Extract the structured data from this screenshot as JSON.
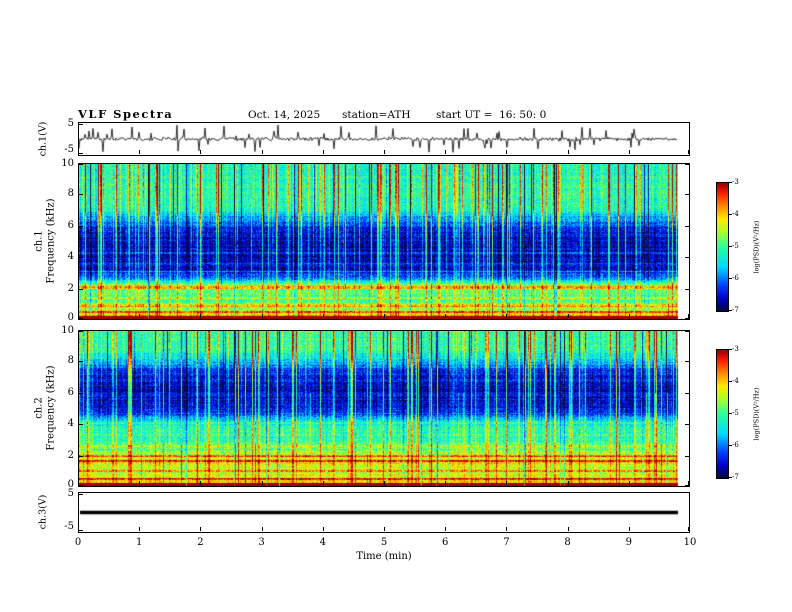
{
  "header": {
    "title": "VLF Spectra",
    "date": "Oct. 14, 2025",
    "station": "station=ATH",
    "start_ut": "start UT =  16: 50: 0"
  },
  "xaxis": {
    "label": "Time (min)",
    "min": 0,
    "max": 10,
    "ticks": [
      0,
      1,
      2,
      3,
      4,
      5,
      6,
      7,
      8,
      9,
      10
    ],
    "data_end_min": 9.8
  },
  "panels": {
    "ch1_wave": {
      "ylabel": "ch.1(V)",
      "ymax_label": "5",
      "ymin_label": "-5",
      "ylim": [
        -5,
        5
      ]
    },
    "ch1_spec": {
      "ylabel_line1": "ch.1",
      "ylabel_line2": "Frequency (kHz)",
      "yticks": [
        0,
        2,
        4,
        6,
        8,
        10
      ],
      "ylim": [
        0,
        10
      ]
    },
    "ch2_spec": {
      "ylabel_line1": "ch.2",
      "ylabel_line2": "Frequency (kHz)",
      "yticks": [
        0,
        2,
        4,
        6,
        8,
        10
      ],
      "ylim": [
        0,
        10
      ]
    },
    "ch3_wave": {
      "ylabel": "ch.3(V)",
      "ymax_label": "5",
      "ymin_label": "-5",
      "ylim": [
        -5,
        5
      ]
    }
  },
  "colorbar": {
    "label": "log(PSD)(V²/Hz)",
    "ticks": [
      -3,
      -4,
      -5,
      -6,
      -7
    ],
    "min": -7,
    "max": -3
  },
  "chart_data": [
    {
      "type": "line",
      "name": "ch1_waveform",
      "ylabel": "ch.1(V)",
      "ylim": [
        -5,
        5
      ],
      "xlim": [
        0,
        10
      ],
      "data_fraction": 0.982,
      "seed": 555,
      "base_noise": 0.55,
      "spike_density": 0.11,
      "spike_min": 1.2,
      "spike_max": 4.2,
      "description": "Noisy channel-1 voltage trace centered at 0 V with many impulsive sferic spikes up to about ±4 V, 0 to 9.8 min"
    },
    {
      "type": "heatmap",
      "name": "ch1_spectrogram",
      "xlim": [
        0,
        10
      ],
      "ylim": [
        0,
        10
      ],
      "vmin": -7,
      "vmax": -3,
      "seed": 20251014,
      "data_fraction": 0.982,
      "profile": [
        [
          0,
          -3.6
        ],
        [
          0.2,
          -3.9
        ],
        [
          0.5,
          -4.4
        ],
        [
          1.0,
          -4.9
        ],
        [
          1.6,
          -5.0
        ],
        [
          2.2,
          -4.7
        ],
        [
          2.6,
          -5.8
        ],
        [
          3.0,
          -6.5
        ],
        [
          4.0,
          -6.7
        ],
        [
          5.0,
          -6.8
        ],
        [
          6.0,
          -6.4
        ],
        [
          6.6,
          -5.8
        ],
        [
          7.2,
          -5.3
        ],
        [
          8.5,
          -5.2
        ],
        [
          10,
          -5.3
        ]
      ],
      "h_lines": [
        [
          0.12,
          1.4,
          0.1
        ],
        [
          0.5,
          0.9,
          0.07
        ],
        [
          0.9,
          0.7,
          0.07
        ],
        [
          1.4,
          0.5,
          0.06
        ],
        [
          2.05,
          0.8,
          0.09
        ],
        [
          3.1,
          0.5,
          0.06
        ],
        [
          3.6,
          0.45,
          0.05
        ],
        [
          4.3,
          0.4,
          0.05
        ],
        [
          5.1,
          0.35,
          0.05
        ]
      ],
      "streak_density": 0.22,
      "streak_gain": 2.2,
      "dark_density": 0.05,
      "noise": 0.8,
      "col_jitter": 0.5,
      "row_jitter": 0.35,
      "description": "VLF spectrogram ch.1: deep-blue low-PSD band ~2.5-6 kHz, green ~-5 background above, hot red/yellow bands below 0.5 kHz, dense vertical sferic streaks"
    },
    {
      "type": "heatmap",
      "name": "ch2_spectrogram",
      "xlim": [
        0,
        10
      ],
      "ylim": [
        0,
        10
      ],
      "vmin": -7,
      "vmax": -3,
      "seed": 987654,
      "data_fraction": 0.982,
      "profile": [
        [
          0,
          -3.7
        ],
        [
          0.2,
          -4.0
        ],
        [
          0.6,
          -4.3
        ],
        [
          1.0,
          -4.5
        ],
        [
          1.6,
          -4.1
        ],
        [
          2.0,
          -4.4
        ],
        [
          2.5,
          -4.9
        ],
        [
          3.2,
          -5.1
        ],
        [
          4.0,
          -5.3
        ],
        [
          4.6,
          -6.2
        ],
        [
          5.2,
          -6.6
        ],
        [
          6.5,
          -6.7
        ],
        [
          7.5,
          -6.4
        ],
        [
          8.2,
          -5.6
        ],
        [
          9.0,
          -5.1
        ],
        [
          10,
          -5.2
        ]
      ],
      "h_lines": [
        [
          0.12,
          1.3,
          0.1
        ],
        [
          0.5,
          0.9,
          0.07
        ],
        [
          1.0,
          0.6,
          0.07
        ],
        [
          1.65,
          0.9,
          0.08
        ],
        [
          1.95,
          0.8,
          0.07
        ],
        [
          2.6,
          0.5,
          0.06
        ],
        [
          3.3,
          0.4,
          0.05
        ],
        [
          4.1,
          0.4,
          0.05
        ]
      ],
      "streak_density": 0.2,
      "streak_gain": 2.2,
      "dark_density": 0.06,
      "noise": 0.8,
      "col_jitter": 0.5,
      "row_jitter": 0.35,
      "description": "VLF spectrogram ch.2: deep-blue low-PSD band ~4.5-8 kHz, orange/yellow horizontal bands 1.5-2 kHz, hot band near 0 kHz, vertical sferic streaks and dark dropouts"
    },
    {
      "type": "line",
      "name": "ch3_waveform",
      "ylabel": "ch.3(V)",
      "ylim": [
        -5,
        5
      ],
      "xlim": [
        0,
        10
      ],
      "data_fraction": 0.982,
      "value": 0.0,
      "description": "Flat thick black line at 0 V (no signal on channel 3)"
    }
  ]
}
